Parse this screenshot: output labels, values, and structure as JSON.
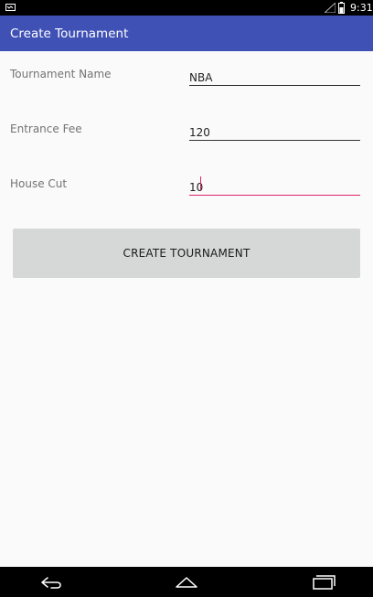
{
  "status_bar": {
    "time": "9:31",
    "icons": [
      "notification-icon",
      "signal-icon",
      "battery-icon"
    ]
  },
  "app_bar": {
    "title": "Create Tournament",
    "color": "#3f51b5"
  },
  "form": {
    "fields": [
      {
        "label": "Tournament Name",
        "value": "NBA",
        "focused": false
      },
      {
        "label": "Entrance Fee",
        "value": "120",
        "focused": false
      },
      {
        "label": "House Cut",
        "value": "10",
        "focused": true
      }
    ],
    "accent_color": "#e0216b"
  },
  "actions": {
    "create_label": "CREATE TOURNAMENT"
  },
  "nav_bar": {
    "icons": [
      "back-icon",
      "home-icon",
      "recents-icon"
    ]
  }
}
